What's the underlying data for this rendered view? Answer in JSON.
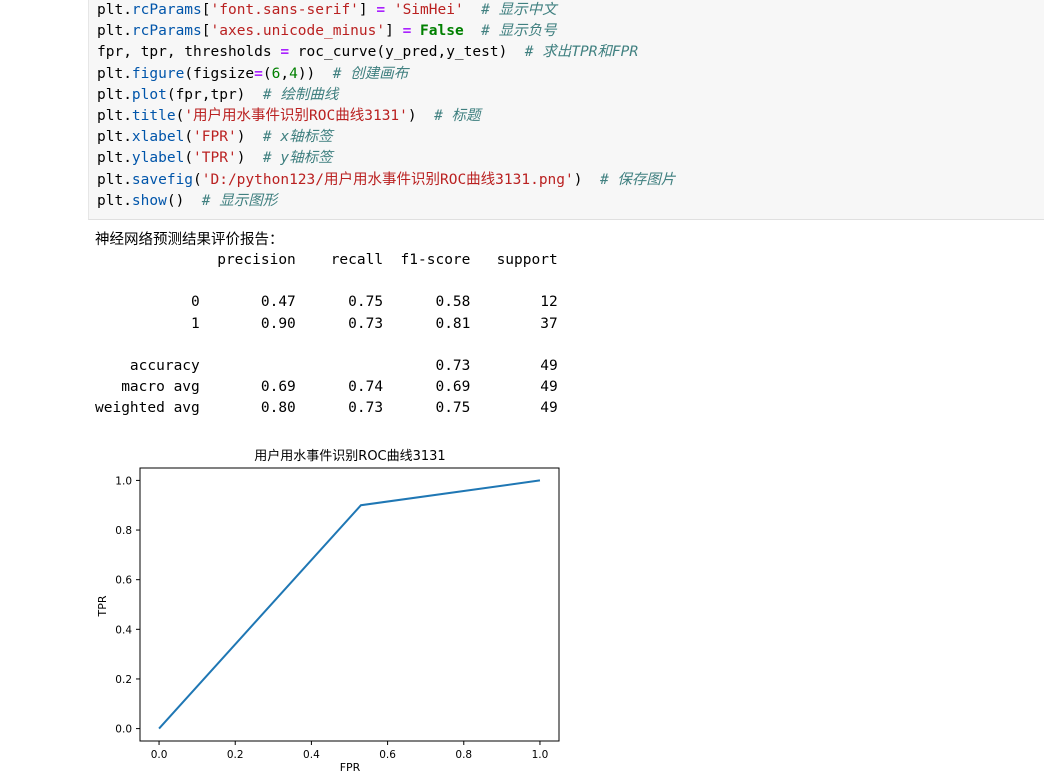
{
  "code": [
    [
      {
        "t": "plt.",
        "c": ""
      },
      {
        "t": "rcParams",
        "c": "kw-attr"
      },
      {
        "t": "[",
        "c": ""
      },
      {
        "t": "'font.sans-serif'",
        "c": "str"
      },
      {
        "t": "] ",
        "c": ""
      },
      {
        "t": "=",
        "c": "op"
      },
      {
        "t": " ",
        "c": ""
      },
      {
        "t": "'SimHei'",
        "c": "str"
      },
      {
        "t": "  ",
        "c": ""
      },
      {
        "t": "# 显示中文",
        "c": "cm"
      }
    ],
    [
      {
        "t": "plt.",
        "c": ""
      },
      {
        "t": "rcParams",
        "c": "kw-attr"
      },
      {
        "t": "[",
        "c": ""
      },
      {
        "t": "'axes.unicode_minus'",
        "c": "str"
      },
      {
        "t": "] ",
        "c": ""
      },
      {
        "t": "=",
        "c": "op"
      },
      {
        "t": " ",
        "c": ""
      },
      {
        "t": "False",
        "c": "kwc"
      },
      {
        "t": "  ",
        "c": ""
      },
      {
        "t": "# 显示负号",
        "c": "cm"
      }
    ],
    [
      {
        "t": "fpr, tpr, thresholds ",
        "c": ""
      },
      {
        "t": "=",
        "c": "op"
      },
      {
        "t": " roc_curve(y_pred,y_test)  ",
        "c": ""
      },
      {
        "t": "# 求出TPR和FPR",
        "c": "cm"
      }
    ],
    [
      {
        "t": "plt.",
        "c": ""
      },
      {
        "t": "figure",
        "c": "kw-attr"
      },
      {
        "t": "(figsize",
        "c": ""
      },
      {
        "t": "=",
        "c": "op"
      },
      {
        "t": "(",
        "c": ""
      },
      {
        "t": "6",
        "c": "num"
      },
      {
        "t": ",",
        "c": ""
      },
      {
        "t": "4",
        "c": "num"
      },
      {
        "t": "))  ",
        "c": ""
      },
      {
        "t": "# 创建画布",
        "c": "cm"
      }
    ],
    [
      {
        "t": "plt.",
        "c": ""
      },
      {
        "t": "plot",
        "c": "kw-attr"
      },
      {
        "t": "(fpr,tpr)  ",
        "c": ""
      },
      {
        "t": "# 绘制曲线",
        "c": "cm"
      }
    ],
    [
      {
        "t": "plt.",
        "c": ""
      },
      {
        "t": "title",
        "c": "kw-attr"
      },
      {
        "t": "(",
        "c": ""
      },
      {
        "t": "'用户用水事件识别ROC曲线3131'",
        "c": "str"
      },
      {
        "t": ")  ",
        "c": ""
      },
      {
        "t": "# 标题",
        "c": "cm"
      }
    ],
    [
      {
        "t": "plt.",
        "c": ""
      },
      {
        "t": "xlabel",
        "c": "kw-attr"
      },
      {
        "t": "(",
        "c": ""
      },
      {
        "t": "'FPR'",
        "c": "str"
      },
      {
        "t": ")  ",
        "c": ""
      },
      {
        "t": "# x轴标签",
        "c": "cm"
      }
    ],
    [
      {
        "t": "plt.",
        "c": ""
      },
      {
        "t": "ylabel",
        "c": "kw-attr"
      },
      {
        "t": "(",
        "c": ""
      },
      {
        "t": "'TPR'",
        "c": "str"
      },
      {
        "t": ")  ",
        "c": ""
      },
      {
        "t": "# y轴标签",
        "c": "cm"
      }
    ],
    [
      {
        "t": "plt.",
        "c": ""
      },
      {
        "t": "savefig",
        "c": "kw-attr"
      },
      {
        "t": "(",
        "c": ""
      },
      {
        "t": "'D:/python123/用户用水事件识别ROC曲线3131.png'",
        "c": "str"
      },
      {
        "t": ")  ",
        "c": ""
      },
      {
        "t": "# 保存图片",
        "c": "cm"
      }
    ],
    [
      {
        "t": "plt.",
        "c": ""
      },
      {
        "t": "show",
        "c": "kw-attr"
      },
      {
        "t": "()  ",
        "c": ""
      },
      {
        "t": "# 显示图形",
        "c": "cm"
      }
    ]
  ],
  "output": {
    "label": "神经网络预测结果评价报告：",
    "report_lines": [
      "              precision    recall  f1-score   support",
      "",
      "           0       0.47      0.75      0.58        12",
      "           1       0.90      0.73      0.81        37",
      "",
      "    accuracy                           0.73        49",
      "   macro avg       0.69      0.74      0.69        49",
      "weighted avg       0.80      0.73      0.75        49"
    ]
  },
  "chart_data": {
    "type": "line",
    "title": "用户用水事件识别ROC曲线3131",
    "xlabel": "FPR",
    "ylabel": "TPR",
    "xlim": [
      -0.05,
      1.05
    ],
    "ylim": [
      -0.05,
      1.05
    ],
    "xticks": [
      "0.0",
      "0.2",
      "0.4",
      "0.6",
      "0.8",
      "1.0"
    ],
    "yticks": [
      "0.0",
      "0.2",
      "0.4",
      "0.6",
      "0.8",
      "1.0"
    ],
    "series": [
      {
        "color": "#1f77b4",
        "x": [
          0.0,
          0.53,
          1.0
        ],
        "y": [
          0.0,
          0.9,
          1.0
        ]
      }
    ]
  }
}
